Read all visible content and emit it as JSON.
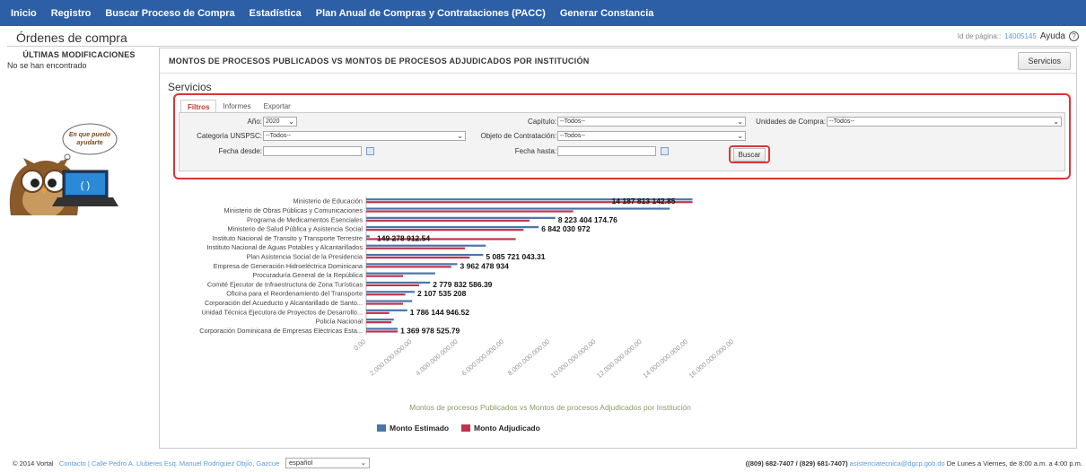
{
  "nav": [
    "Inicio",
    "Registro",
    "Buscar Proceso de Compra",
    "Estadística",
    "Plan Anual de Compras y Contrataciones (PACC)",
    "Generar Constancia"
  ],
  "page": {
    "title": "Órdenes de compra",
    "id_label": "Id de página::",
    "id_value": "14005145",
    "help": "Ayuda"
  },
  "sidebar": {
    "heading": "ÚLTIMAS MODIFICACIONES",
    "empty": "No se han encontrado",
    "bubble_line1": "En que puedo",
    "bubble_line2": "ayudarte"
  },
  "main": {
    "title": "MONTOS DE PROCESOS PUBLICADOS VS MONTOS DE PROCESOS ADJUDICADOS POR INSTITUCIÓN",
    "servicios_button": "Servicios",
    "section_title": "Servicios",
    "tabs": [
      "Filtros",
      "Informes",
      "Exportar"
    ]
  },
  "filters": {
    "anio_label": "Año:",
    "anio_value": "2020",
    "capitulo_label": "Capítulo:",
    "capitulo_value": "--Todos--",
    "unidades_label": "Unidades de Compra:",
    "unidades_value": "--Todos--",
    "categoria_label": "Categoría UNSPSC:",
    "categoria_value": "--Todos--",
    "objeto_label": "Objeto de Contratación:",
    "objeto_value": "--Todos--",
    "desde_label": "Fecha desde:",
    "hasta_label": "Fecha hasta:",
    "buscar": "Buscar"
  },
  "chart_data": {
    "type": "bar",
    "orientation": "horizontal",
    "title": "Montos de procesos Publicados vs Montos de procesos Adjudicados por Institución",
    "categories": [
      "Ministerio de Educación",
      "Ministerio de Obras Públicas y Comunicaciones",
      "Programa de Medicamentos Esenciales",
      "Ministerio de Salud Pública y Asistencia Social",
      "Instituto Nacional de Transito y Transporte Terrestre",
      "Instituto Nacional de Aguas Potables y Alcantarillados",
      "Plan Asistencia Social de la Presidencia",
      "Empresa de Generación Hidroeléctrica Dominicana",
      "Procuraduría General de la República",
      "Comité Ejecutor de Infraestructura de Zona Turísticas",
      "Oficina para el Reordenamiento del Transporte",
      "Corporación del Acueducto y Alcantarillado de Santo...",
      "Unidad Técnica Ejecutora de Proyectos de Desarrollo...",
      "Policía Nacional",
      "Corporación Dominicana de Empresas Eléctricas Esta..."
    ],
    "series": [
      {
        "name": "Monto Estimado",
        "color": "#4a74aa",
        "values": [
          14187813142.85,
          13200000000,
          8223404174.76,
          7500000000,
          149278912.54,
          5200000000,
          5085721043.31,
          3962478934,
          3000000000,
          2779832586.39,
          2107535208,
          2000000000,
          1786144946.52,
          1200000000,
          1369978525.79
        ]
      },
      {
        "name": "Monto Adjudicado",
        "color": "#c0334d",
        "values": [
          14187813142.85,
          9000000000,
          7100000000,
          6842030972,
          6500000000,
          4300000000,
          4500000000,
          3700000000,
          1600000000,
          2300000000,
          1700000000,
          1600000000,
          1000000000,
          1100000000,
          1369978525.79
        ]
      }
    ],
    "data_labels": [
      "14 187 813 142.85",
      "8 223 404 174.76",
      "6 842 030 972",
      "149 278 912.54",
      "5 085 721 043.31",
      "3 962 478 934",
      "2 779 832 586.39",
      "2 107 535 208",
      "1 786 144 946.52",
      "1 369 978 525.79"
    ],
    "x_ticks": [
      "0,00",
      "2.000.000.000,00",
      "4.000.000.000,00",
      "6.000.000.000,00",
      "8.000.000.000,00",
      "10.000.000.000,00",
      "12.000.000.000,00",
      "14.000.000.000,00",
      "16.000.000.000,00"
    ],
    "xlim": [
      0,
      16000000000
    ],
    "legend_position": "bottom"
  },
  "footer": {
    "copyright": "© 2014 Vortal",
    "contact": "Contacto | Calle Pedro A. Lluberes Esq. Manuel Rodríguez Objío, Gazcue",
    "language": "español",
    "phones": "((809) 682-7407 / (829) 681-7407)",
    "email": "asistenciatecnica@dgcp.gob.do",
    "hours": "De Lunes a Viernes, de 8:00 a.m. a 4:00 p.m."
  }
}
